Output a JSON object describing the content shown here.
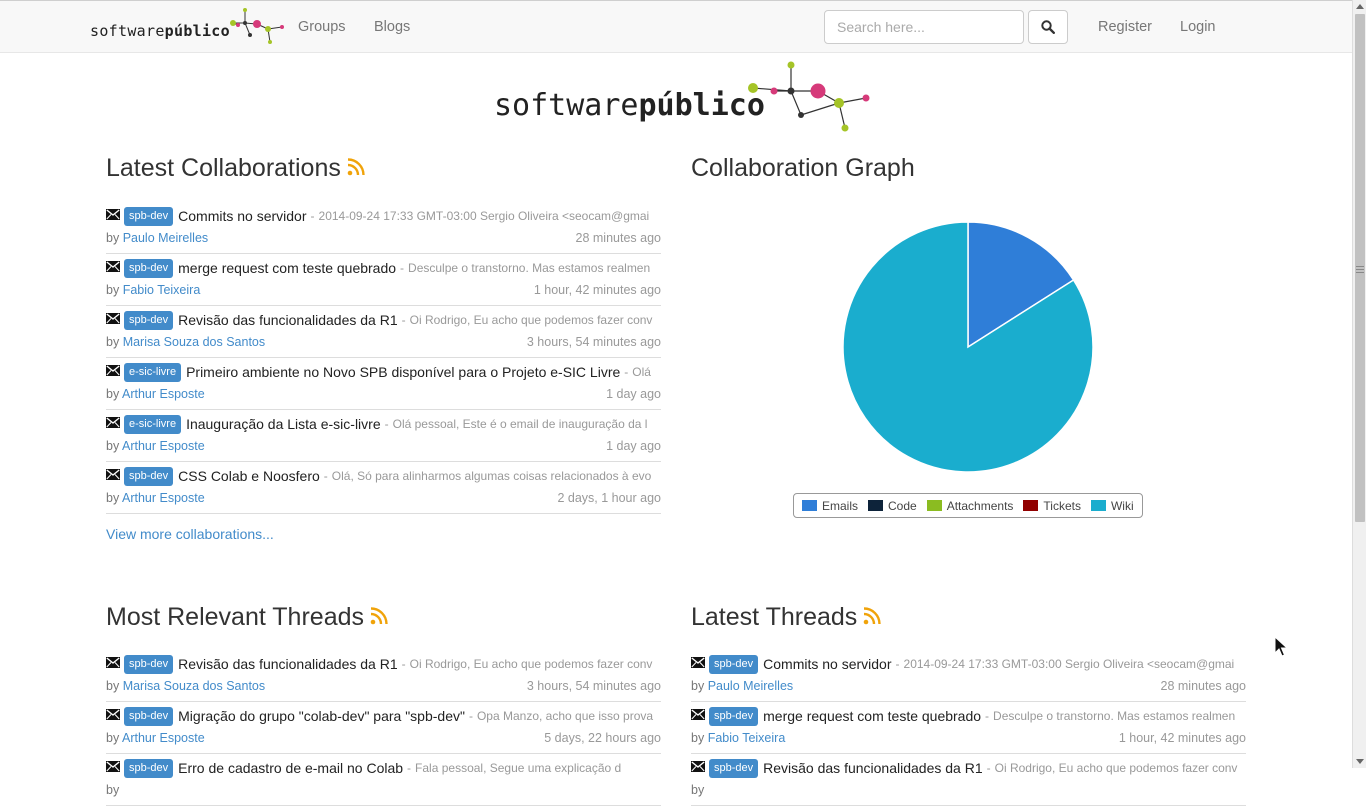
{
  "navbar": {
    "brand_light": "software",
    "brand_bold": "público",
    "links": [
      "Groups",
      "Blogs"
    ],
    "search_placeholder": "Search here...",
    "register": "Register",
    "login": "Login"
  },
  "logo": {
    "light": "software",
    "bold": "público"
  },
  "latest_collaborations": {
    "title": "Latest Collaborations",
    "items": [
      {
        "tag": "spb-dev",
        "title": "Commits no servidor",
        "desc": "2014-09-24 17:33 GMT-03:00 Sergio Oliveira <seocam@gmai",
        "by": "by",
        "author": "Paulo Meirelles",
        "time": "28 minutes ago"
      },
      {
        "tag": "spb-dev",
        "title": "merge request com teste quebrado",
        "desc": "Desculpe o transtorno. Mas estamos realmen",
        "by": "by",
        "author": "Fabio Teixeira",
        "time": "1 hour, 42 minutes ago"
      },
      {
        "tag": "spb-dev",
        "title": "Revisão das funcionalidades da R1",
        "desc": "Oi Rodrigo, Eu acho que podemos fazer conv",
        "by": "by",
        "author": "Marisa Souza dos Santos",
        "time": "3 hours, 54 minutes ago"
      },
      {
        "tag": "e-sic-livre",
        "title": "Primeiro ambiente no Novo SPB disponível para o Projeto e-SIC Livre",
        "desc": "Olá",
        "by": "by",
        "author": "Arthur Esposte",
        "time": "1 day ago"
      },
      {
        "tag": "e-sic-livre",
        "title": "Inauguração da Lista e-sic-livre",
        "desc": "Olá pessoal, Este é o email de inauguração da l",
        "by": "by",
        "author": "Arthur Esposte",
        "time": "1 day ago"
      },
      {
        "tag": "spb-dev",
        "title": "CSS Colab e Noosfero",
        "desc": "Olá, Só para alinharmos algumas coisas relacionados à evo",
        "by": "by",
        "author": "Arthur Esposte",
        "time": "2 days, 1 hour ago"
      }
    ],
    "view_more": "View more collaborations..."
  },
  "collaboration_graph": {
    "title": "Collaboration Graph"
  },
  "chart_data": {
    "type": "pie",
    "categories": [
      "Emails",
      "Code",
      "Attachments",
      "Tickets",
      "Wiki"
    ],
    "values": [
      16,
      0,
      0,
      0,
      84
    ],
    "colors": [
      "#2f7ed8",
      "#0d233a",
      "#8bbc21",
      "#910000",
      "#1aadce"
    ],
    "legend_position": "bottom"
  },
  "most_relevant_threads": {
    "title": "Most Relevant Threads",
    "items": [
      {
        "tag": "spb-dev",
        "title": "Revisão das funcionalidades da R1",
        "desc": "Oi Rodrigo, Eu acho que podemos fazer conv",
        "by": "by",
        "author": "Marisa Souza dos Santos",
        "time": "3 hours, 54 minutes ago"
      },
      {
        "tag": "spb-dev",
        "title": "Migração do grupo \"colab-dev\" para \"spb-dev\"",
        "desc": "Opa Manzo, acho que isso prova",
        "by": "by",
        "author": "Arthur Esposte",
        "time": "5 days, 22 hours ago"
      },
      {
        "tag": "spb-dev",
        "title": "Erro de cadastro de e-mail no Colab",
        "desc": "Fala pessoal, Segue uma explicação d",
        "by": "by",
        "author": "",
        "time": ""
      }
    ]
  },
  "latest_threads": {
    "title": "Latest Threads",
    "items": [
      {
        "tag": "spb-dev",
        "title": "Commits no servidor",
        "desc": "2014-09-24 17:33 GMT-03:00 Sergio Oliveira <seocam@gmai",
        "by": "by",
        "author": "Paulo Meirelles",
        "time": "28 minutes ago"
      },
      {
        "tag": "spb-dev",
        "title": "merge request com teste quebrado",
        "desc": "Desculpe o transtorno. Mas estamos realmen",
        "by": "by",
        "author": "Fabio Teixeira",
        "time": "1 hour, 42 minutes ago"
      },
      {
        "tag": "spb-dev",
        "title": "Revisão das funcionalidades da R1",
        "desc": "Oi Rodrigo, Eu acho que podemos fazer conv",
        "by": "by",
        "author": "",
        "time": ""
      }
    ]
  }
}
